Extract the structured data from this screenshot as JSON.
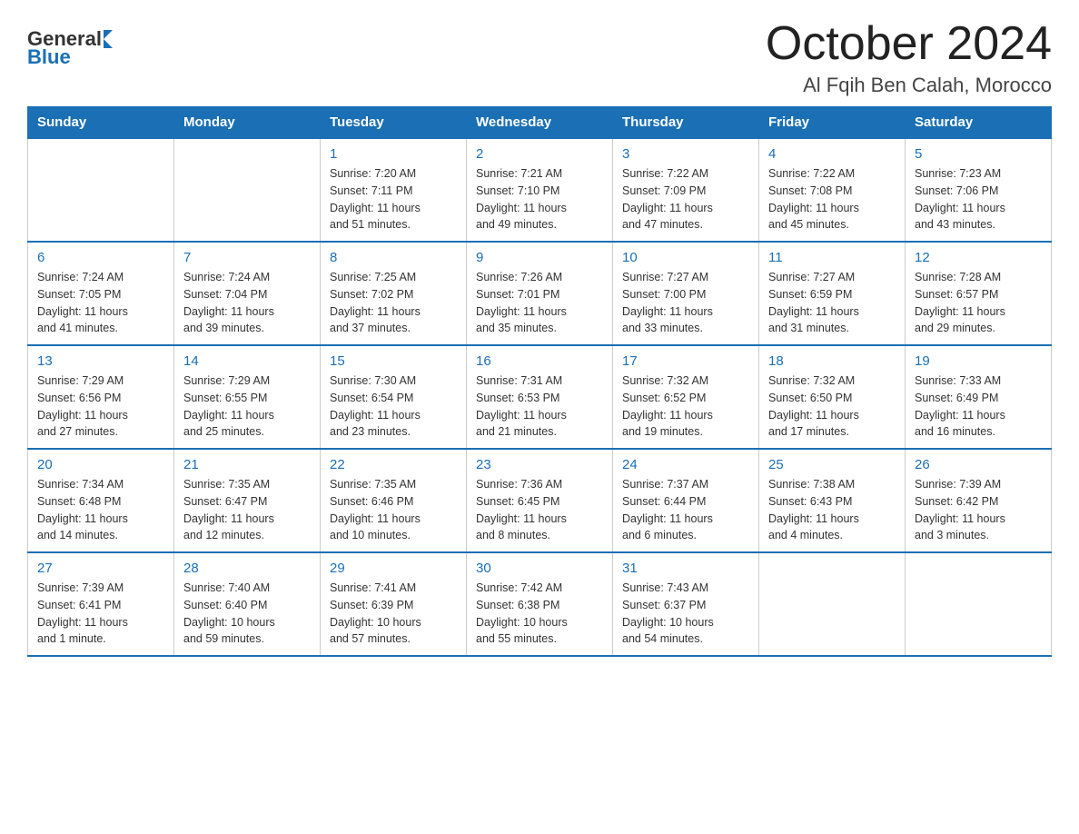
{
  "logo": {
    "general": "General",
    "blue": "Blue"
  },
  "title": "October 2024",
  "subtitle": "Al Fqih Ben Calah, Morocco",
  "headers": [
    "Sunday",
    "Monday",
    "Tuesday",
    "Wednesday",
    "Thursday",
    "Friday",
    "Saturday"
  ],
  "weeks": [
    [
      {
        "day": "",
        "info": ""
      },
      {
        "day": "",
        "info": ""
      },
      {
        "day": "1",
        "info": "Sunrise: 7:20 AM\nSunset: 7:11 PM\nDaylight: 11 hours\nand 51 minutes."
      },
      {
        "day": "2",
        "info": "Sunrise: 7:21 AM\nSunset: 7:10 PM\nDaylight: 11 hours\nand 49 minutes."
      },
      {
        "day": "3",
        "info": "Sunrise: 7:22 AM\nSunset: 7:09 PM\nDaylight: 11 hours\nand 47 minutes."
      },
      {
        "day": "4",
        "info": "Sunrise: 7:22 AM\nSunset: 7:08 PM\nDaylight: 11 hours\nand 45 minutes."
      },
      {
        "day": "5",
        "info": "Sunrise: 7:23 AM\nSunset: 7:06 PM\nDaylight: 11 hours\nand 43 minutes."
      }
    ],
    [
      {
        "day": "6",
        "info": "Sunrise: 7:24 AM\nSunset: 7:05 PM\nDaylight: 11 hours\nand 41 minutes."
      },
      {
        "day": "7",
        "info": "Sunrise: 7:24 AM\nSunset: 7:04 PM\nDaylight: 11 hours\nand 39 minutes."
      },
      {
        "day": "8",
        "info": "Sunrise: 7:25 AM\nSunset: 7:02 PM\nDaylight: 11 hours\nand 37 minutes."
      },
      {
        "day": "9",
        "info": "Sunrise: 7:26 AM\nSunset: 7:01 PM\nDaylight: 11 hours\nand 35 minutes."
      },
      {
        "day": "10",
        "info": "Sunrise: 7:27 AM\nSunset: 7:00 PM\nDaylight: 11 hours\nand 33 minutes."
      },
      {
        "day": "11",
        "info": "Sunrise: 7:27 AM\nSunset: 6:59 PM\nDaylight: 11 hours\nand 31 minutes."
      },
      {
        "day": "12",
        "info": "Sunrise: 7:28 AM\nSunset: 6:57 PM\nDaylight: 11 hours\nand 29 minutes."
      }
    ],
    [
      {
        "day": "13",
        "info": "Sunrise: 7:29 AM\nSunset: 6:56 PM\nDaylight: 11 hours\nand 27 minutes."
      },
      {
        "day": "14",
        "info": "Sunrise: 7:29 AM\nSunset: 6:55 PM\nDaylight: 11 hours\nand 25 minutes."
      },
      {
        "day": "15",
        "info": "Sunrise: 7:30 AM\nSunset: 6:54 PM\nDaylight: 11 hours\nand 23 minutes."
      },
      {
        "day": "16",
        "info": "Sunrise: 7:31 AM\nSunset: 6:53 PM\nDaylight: 11 hours\nand 21 minutes."
      },
      {
        "day": "17",
        "info": "Sunrise: 7:32 AM\nSunset: 6:52 PM\nDaylight: 11 hours\nand 19 minutes."
      },
      {
        "day": "18",
        "info": "Sunrise: 7:32 AM\nSunset: 6:50 PM\nDaylight: 11 hours\nand 17 minutes."
      },
      {
        "day": "19",
        "info": "Sunrise: 7:33 AM\nSunset: 6:49 PM\nDaylight: 11 hours\nand 16 minutes."
      }
    ],
    [
      {
        "day": "20",
        "info": "Sunrise: 7:34 AM\nSunset: 6:48 PM\nDaylight: 11 hours\nand 14 minutes."
      },
      {
        "day": "21",
        "info": "Sunrise: 7:35 AM\nSunset: 6:47 PM\nDaylight: 11 hours\nand 12 minutes."
      },
      {
        "day": "22",
        "info": "Sunrise: 7:35 AM\nSunset: 6:46 PM\nDaylight: 11 hours\nand 10 minutes."
      },
      {
        "day": "23",
        "info": "Sunrise: 7:36 AM\nSunset: 6:45 PM\nDaylight: 11 hours\nand 8 minutes."
      },
      {
        "day": "24",
        "info": "Sunrise: 7:37 AM\nSunset: 6:44 PM\nDaylight: 11 hours\nand 6 minutes."
      },
      {
        "day": "25",
        "info": "Sunrise: 7:38 AM\nSunset: 6:43 PM\nDaylight: 11 hours\nand 4 minutes."
      },
      {
        "day": "26",
        "info": "Sunrise: 7:39 AM\nSunset: 6:42 PM\nDaylight: 11 hours\nand 3 minutes."
      }
    ],
    [
      {
        "day": "27",
        "info": "Sunrise: 7:39 AM\nSunset: 6:41 PM\nDaylight: 11 hours\nand 1 minute."
      },
      {
        "day": "28",
        "info": "Sunrise: 7:40 AM\nSunset: 6:40 PM\nDaylight: 10 hours\nand 59 minutes."
      },
      {
        "day": "29",
        "info": "Sunrise: 7:41 AM\nSunset: 6:39 PM\nDaylight: 10 hours\nand 57 minutes."
      },
      {
        "day": "30",
        "info": "Sunrise: 7:42 AM\nSunset: 6:38 PM\nDaylight: 10 hours\nand 55 minutes."
      },
      {
        "day": "31",
        "info": "Sunrise: 7:43 AM\nSunset: 6:37 PM\nDaylight: 10 hours\nand 54 minutes."
      },
      {
        "day": "",
        "info": ""
      },
      {
        "day": "",
        "info": ""
      }
    ]
  ]
}
